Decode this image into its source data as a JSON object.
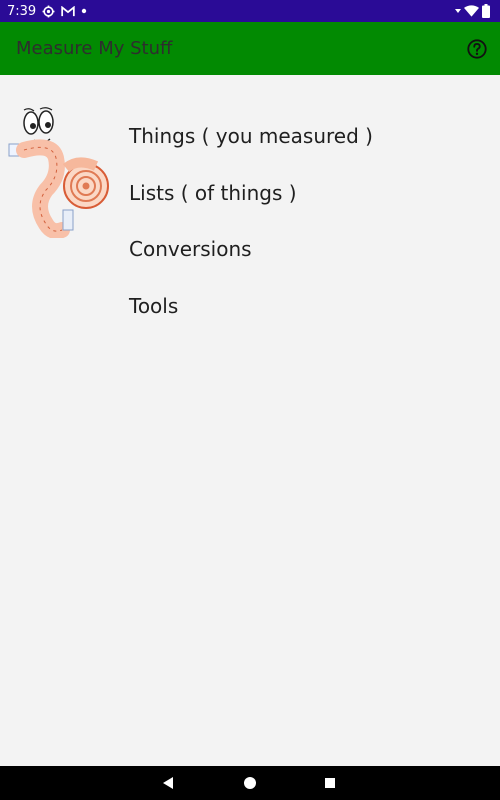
{
  "status_bar": {
    "time": "7:39",
    "icons": [
      "settings-gear-icon",
      "gmail-icon",
      "notification-dot-icon",
      "wifi-icon",
      "battery-icon"
    ],
    "background": "#2a0b96"
  },
  "app_bar": {
    "title": "Measure My Stuff",
    "background": "#028a02",
    "help_icon": "help-circle-icon"
  },
  "menu": {
    "items": [
      {
        "label": "Things ( you measured )"
      },
      {
        "label": "Lists ( of things )"
      },
      {
        "label": "Conversions"
      },
      {
        "label": "Tools"
      }
    ]
  },
  "mascot": {
    "icon": "tape-measure-mascot"
  },
  "nav_bar": {
    "icons": [
      "back-icon",
      "home-icon",
      "recents-icon"
    ]
  }
}
